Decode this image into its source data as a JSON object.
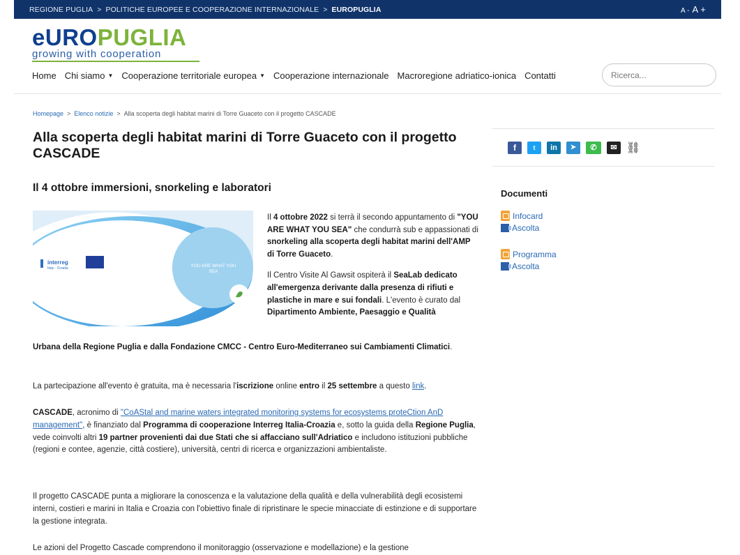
{
  "topbar": {
    "crumbs": [
      "REGIONE PUGLIA",
      "POLITICHE EUROPEE E COOPERAZIONE INTERNAZIONALE",
      "EUROPUGLIA"
    ],
    "sep": ">",
    "font_small": "A -",
    "font_big": "A +"
  },
  "logo": {
    "e": "e",
    "uro": "URO",
    "puglia": "PUGLIA",
    "tagline": "growing with cooperation"
  },
  "nav": {
    "items": [
      "Home",
      "Chi siamo",
      "Cooperazione territoriale europea",
      "Cooperazione internazionale",
      "Macroregione adriatico-ionica",
      "Contatti"
    ]
  },
  "search": {
    "placeholder": "Ricerca..."
  },
  "breadcrumb": {
    "home": "Homepage",
    "list": "Elenco notizie",
    "current": "Alla scoperta degli habitat marini di Torre Guaceto con il progetto CASCADE",
    "sep": ">"
  },
  "article": {
    "title": "Alla scoperta degli habitat marini di Torre Guaceto con il progetto CASCADE",
    "subtitle": "Il 4 ottobre immersioni, snorkeling e laboratori",
    "image_caption": "YOU ARE WHAT YOU SEA",
    "image_logo": "interreg",
    "image_logo_sub": "Italy - Croatia",
    "p1": {
      "a": "Il ",
      "b": "4 ottobre 2022",
      "c": " si terrà il secondo appuntamento di ",
      "d": "\"YOU ARE WHAT YOU SEA\"",
      "e": " che condurrà sub e appassionati di ",
      "f": "snorkeling alla scoperta degli habitat marini dell'AMP di Torre Guaceto",
      "g": "."
    },
    "p2": {
      "a": "Il Centro Visite Al Gawsit ospiterà il ",
      "b": "SeaLab dedicato all'emergenza derivante dalla presenza di rifiuti e plastiche in mare e sui fondali",
      "c": ". L'evento è curato dal ",
      "d": "Dipartimento Ambiente, Paesaggio e Qualità",
      "e": "Urbana della Regione Puglia e dalla Fondazione CMCC - Centro Euro-Mediterraneo sui Cambiamenti Climatici",
      "f": "."
    },
    "p3": {
      "a": "La partecipazione all'evento è gratuita, ma è necessaria l'",
      "b": "iscrizione",
      "c": " online ",
      "d": "entro",
      "e": " il ",
      "f": "25 settembre",
      "g": " a questo ",
      "link": "link",
      "h": "."
    },
    "p4": {
      "a": "CASCADE",
      "b": ", acronimo di ",
      "link": "\"CoAStal and marine waters integrated monitoring systems for ecosystems proteCtion AnD management\"",
      "c": ", è finanziato dal ",
      "d": "Programma di cooperazione Interreg Italia-Croazia",
      "e": " e, sotto la guida della ",
      "f": "Regione Puglia",
      "g": ", vede coinvolti altri ",
      "h": "19 partner provenienti dai due Stati che si affacciano sull'Adriatico",
      "i": " e includono istituzioni pubbliche (regioni e contee, agenzie, città costiere), università, centri di ricerca e organizzazioni ambientaliste."
    },
    "p5": "Il progetto CASCADE punta a migliorare la conoscenza e la valutazione della qualità e della vulnerabilità degli ecosistemi interni, costieri e marini in Italia e Croazia con l'obiettivo finale di ripristinare le specie minacciate di estinzione e di supportare la gestione integrata.",
    "p6": "Le azioni del Progetto Cascade comprendono il monitoraggio (osservazione e modellazione) e la gestione"
  },
  "social": {
    "facebook": "f",
    "twitter": "t",
    "linkedin": "in",
    "telegram": "➤",
    "whatsapp": "✆",
    "email": "✉",
    "link": "⛓"
  },
  "documents": {
    "title": "Documenti",
    "items": [
      {
        "label": "Infocard",
        "listen": "Ascolta"
      },
      {
        "label": "Programma",
        "listen": "Ascolta"
      }
    ]
  },
  "colors": {
    "topbar": "#10336a",
    "brand_blue": "#0f3f8e",
    "brand_green": "#7db33b",
    "link": "#2a6ab3"
  }
}
